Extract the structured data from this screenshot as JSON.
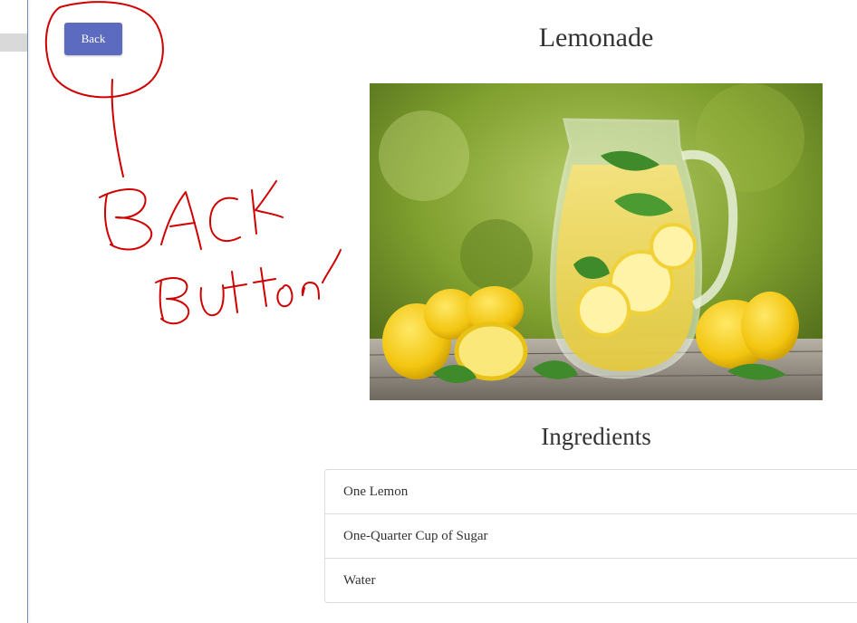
{
  "back_button": {
    "label": "Back"
  },
  "page_title": "Lemonade",
  "image": {
    "icon": "lemonade-pitcher-photo"
  },
  "ingredients": {
    "title": "Ingredients",
    "items": [
      "One Lemon",
      "One-Quarter Cup of Sugar",
      "Water"
    ]
  },
  "annotation": {
    "text_line1": "BACK",
    "text_line2": "Button",
    "color": "#d00000"
  },
  "colors": {
    "button": "#5c6bc0",
    "list_border": "#dddddd"
  }
}
